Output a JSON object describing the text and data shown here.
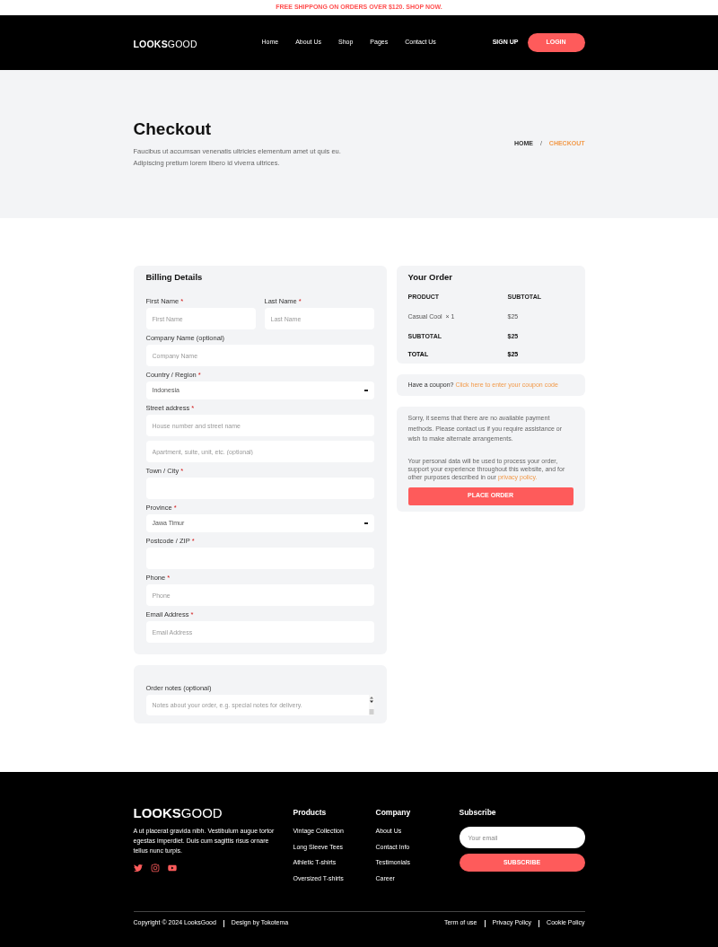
{
  "announcement": "FREE SHIPPONG ON ORDERS OVER $120. SHOP NOW.",
  "header": {
    "logo": "**LOOKS**GOOD",
    "nav": [
      "Home",
      "About Us",
      "Shop",
      "Pages",
      "Contact Us"
    ],
    "signup": "SIGN UP",
    "login": "LOGIN"
  },
  "hero": {
    "title": "Checkout",
    "subtitle_lines": [
      "Faucibus ut accumsan venenatis ultricies elementum amet ut quis eu.",
      "Adipiscing pretium lorem libero id viverra ultrices."
    ],
    "breadcrumb": [
      {
        "label": "HOME",
        "current": false
      },
      {
        "label": "CHECKOUT",
        "current": true
      }
    ],
    "separator": "/"
  },
  "billing": {
    "title": "Billing Details",
    "required_mark": "*",
    "rows": [
      {
        "fields": [
          {
            "label": "First Name",
            "required": true,
            "kind": "text",
            "placeholder": "First Name"
          },
          {
            "label": "Last Name",
            "required": true,
            "kind": "text",
            "placeholder": "Last Name"
          }
        ]
      },
      {
        "fields": [
          {
            "label": "Company Name (optional)",
            "required": false,
            "kind": "text",
            "placeholder": "Company Name"
          }
        ]
      },
      {
        "fields": [
          {
            "label": "Country / Region",
            "required": true,
            "kind": "select",
            "value": "Indonesia"
          }
        ]
      },
      {
        "fields": [
          {
            "label": "Street address",
            "required": true,
            "kind": "text",
            "placeholder": "House number and street name"
          }
        ]
      },
      {
        "fields": [
          {
            "kind": "text",
            "placeholder": "Apartment, suite, unit, etc. (optional)"
          }
        ]
      },
      {
        "fields": [
          {
            "label": "Town / City",
            "required": true,
            "kind": "text"
          }
        ]
      },
      {
        "fields": [
          {
            "label": "Province",
            "required": true,
            "kind": "select",
            "value": "Jawa Timur"
          }
        ]
      },
      {
        "fields": [
          {
            "label": "Postcode / ZIP",
            "required": true,
            "kind": "text"
          }
        ]
      },
      {
        "fields": [
          {
            "label": "Phone",
            "required": true,
            "kind": "text",
            "placeholder": "Phone"
          }
        ]
      },
      {
        "fields": [
          {
            "label": "Email Address",
            "required": true,
            "kind": "text",
            "placeholder": "Email Address"
          }
        ]
      }
    ]
  },
  "order_notes": {
    "label": "Order notes (optional)",
    "placeholder": "Notes about your order, e.g. special notes for delivery."
  },
  "your_order": {
    "title": "Your Order",
    "columns": [
      "PRODUCT",
      "SUBTOTAL"
    ],
    "rows": [
      {
        "kind": "item",
        "product": "Casual Cool",
        "quantity": "× 1",
        "value": "$25"
      },
      {
        "kind": "subtotal",
        "product": "SUBTOTAL",
        "value": "$25"
      },
      {
        "kind": "total",
        "product": "TOTAL",
        "value": "$25"
      }
    ]
  },
  "coupon": {
    "text": "Have a coupon?",
    "link": "Click here to enter your coupon code"
  },
  "payment": {
    "notice": "Sorry, it seems that there are no available payment methods. Please contact us if you require assistance or wish to make alternate arrangements.",
    "privacy_text": "Your personal data will be used to process your order, support your experience throughout this website, and for other purposes described in our",
    "privacy_link": "privacy policy.",
    "button": "PLACE ORDER"
  },
  "footer": {
    "logo": "**LOOKS**GOOD",
    "description": "A ut placerat gravida nibh. Vestibulum augue tortor egestas imperdiet. Duis cum sagittis risus ornare tellus nunc turpis.",
    "social": [
      {
        "kind": "twitter"
      },
      {
        "kind": "instagram"
      },
      {
        "kind": "youtube"
      }
    ],
    "columns": [
      {
        "title": "Products",
        "links": [
          "Vintage Collection",
          "Long Sleeve Tees",
          "Athletic T-shirts",
          "Oversized T-shirts"
        ]
      },
      {
        "title": "Company",
        "links": [
          "About Us",
          "Contact Info",
          "Testimonials",
          "Career"
        ]
      }
    ],
    "subscribe": {
      "title": "Subscribe",
      "placeholder": "Your email",
      "button": "SUBSCRIBE"
    },
    "bottom_left": [
      "Copyright © 2024 LooksGood",
      "Design by Tokotema"
    ],
    "bottom_right": [
      "Term of use",
      "Privacy Policy",
      "Cookie Policy"
    ]
  }
}
